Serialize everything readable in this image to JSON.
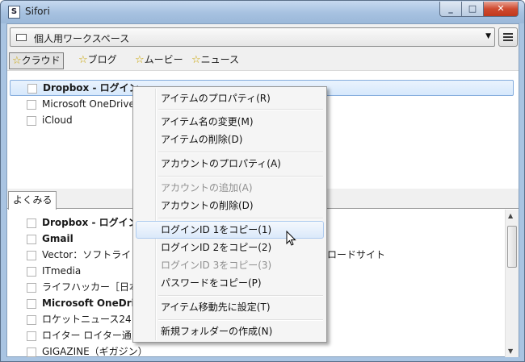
{
  "window": {
    "title": "Sifori",
    "icon": "S"
  },
  "workspace": {
    "selected": "個人用ワークスペース"
  },
  "tags": [
    {
      "label": "クラウド"
    },
    {
      "label": "ブログ"
    },
    {
      "label": "ムービー"
    },
    {
      "label": "ニュース"
    }
  ],
  "top_list": [
    {
      "label": "Dropbox - ログイン"
    },
    {
      "label": "Microsoft OneDrive"
    },
    {
      "label": "iCloud"
    }
  ],
  "bottom_tab": "よくみる",
  "bottom_list": [
    {
      "label": "Dropbox - ログイン"
    },
    {
      "label": "Gmail"
    },
    {
      "label": "Vector：ソフトライ"
    },
    {
      "label": "ITmedia"
    },
    {
      "label": "ライフハッカー［日本"
    },
    {
      "label": "Microsoft OneDriv"
    },
    {
      "label": "ロケットニュース24"
    },
    {
      "label": "ロイター ロイター通"
    },
    {
      "label": "GIGAZINE（ギガジン）"
    }
  ],
  "bottom_trailing_text": "ロードサイト",
  "context_menu": [
    {
      "label": "アイテムのプロパティ(R)"
    },
    {
      "label": "アイテム名の変更(M)"
    },
    {
      "label": "アイテムの削除(D)"
    },
    {
      "label": "アカウントのプロパティ(A)"
    },
    {
      "label": "アカウントの追加(A)"
    },
    {
      "label": "アカウントの削除(D)"
    },
    {
      "label": "ログインID 1をコピー(1)"
    },
    {
      "label": "ログインID 2をコピー(2)"
    },
    {
      "label": "ログインID 3をコピー(3)"
    },
    {
      "label": "パスワードをコピー(P)"
    },
    {
      "label": "アイテム移動先に設定(T)"
    },
    {
      "label": "新規フォルダーの作成(N)"
    }
  ],
  "icons": {
    "tag": "star-icon",
    "item": "checkbox-icon",
    "workspace": "workspace-icon",
    "menu": "hamburger-icon"
  },
  "colors": {
    "titlebar": "#a6c1e0",
    "selection": "#d6e8fc",
    "close_button": "#c0381c",
    "star": "#c9a400"
  }
}
